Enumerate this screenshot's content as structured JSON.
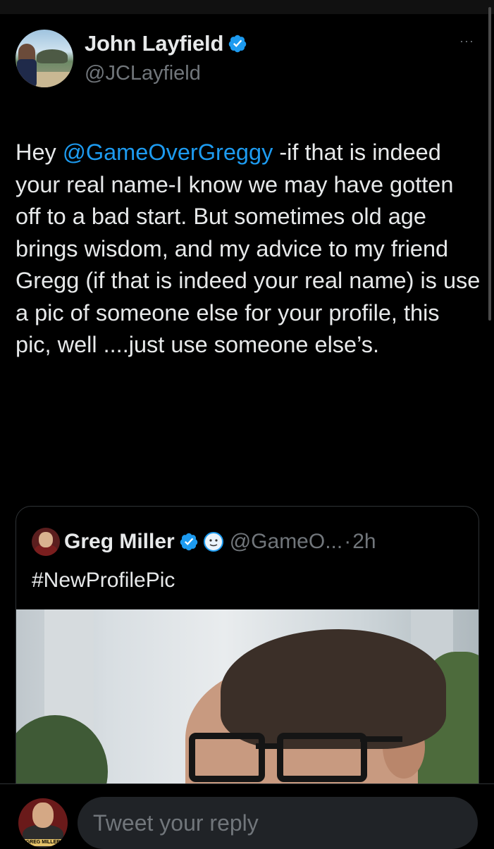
{
  "author": {
    "display_name": "John Layfield",
    "handle": "@JCLayfield",
    "verified": true,
    "avatar": "beach-scene-avatar"
  },
  "more_icon": "···",
  "tweet": {
    "prefix": "Hey ",
    "mention": "@GameOverGreggy",
    "body": " -if that is indeed your real name-I know we may have gotten off to a bad start. But sometimes old age brings wisdom, and my advice to my friend Gregg (if that is indeed your real name) is use a pic of someone else for your profile, this pic, well ....just use someone else’s."
  },
  "quoted_tweet": {
    "display_name": "Greg Miller",
    "verified": true,
    "emoji_icon": "smiling-face-emoji",
    "handle": "@GameO...",
    "separator": "·",
    "time": "2h",
    "text": "#NewProfilePic",
    "media": "profile-photo-man-with-glasses"
  },
  "reply": {
    "placeholder": "Tweet your reply",
    "avatar_label": "GREG MILLER"
  },
  "colors": {
    "background": "#000000",
    "text": "#e7e9ea",
    "secondary": "#71767b",
    "accent": "#1d9bf0",
    "border": "#2f3336",
    "input_bg": "#202327"
  }
}
